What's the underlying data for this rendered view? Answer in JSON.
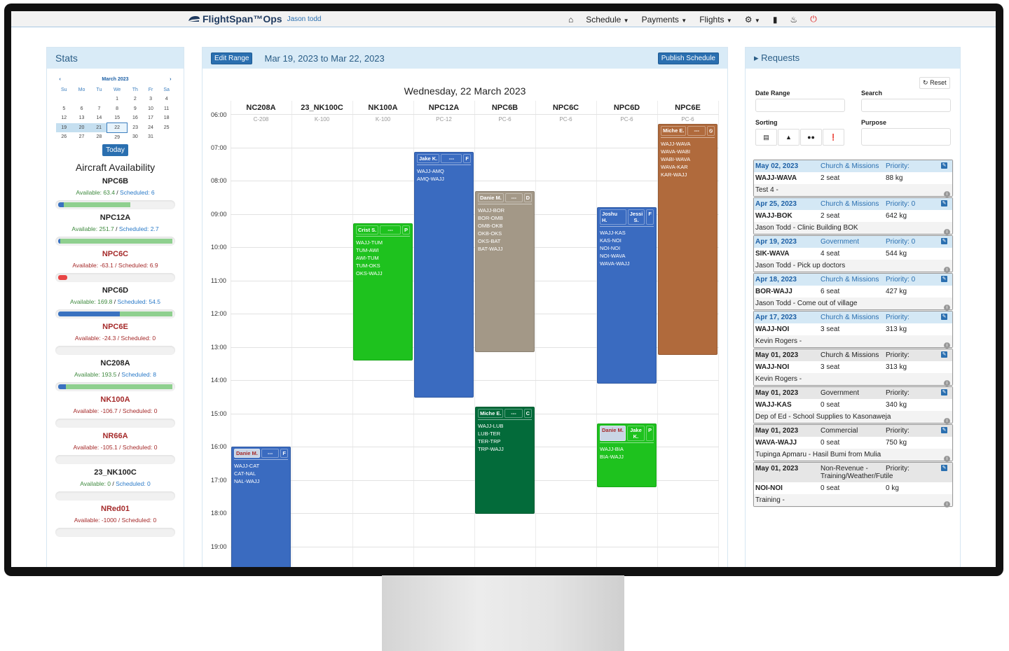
{
  "nav": {
    "brand": "FlightSpan™Ops",
    "user": "Jason todd",
    "items": [
      {
        "label": "Schedule"
      },
      {
        "label": "Payments"
      },
      {
        "label": "Flights"
      }
    ]
  },
  "stats": {
    "title": "Stats",
    "calendar": {
      "month": "March 2023",
      "prev": "‹",
      "next": "›",
      "weekdays": [
        "Su",
        "Mo",
        "Tu",
        "We",
        "Th",
        "Fr",
        "Sa"
      ],
      "weeks": [
        [
          "",
          "",
          "",
          "1",
          "2",
          "3",
          "4"
        ],
        [
          "5",
          "6",
          "7",
          "8",
          "9",
          "10",
          "11"
        ],
        [
          "12",
          "13",
          "14",
          "15",
          "16",
          "17",
          "18"
        ],
        [
          "19",
          "20",
          "21",
          "22",
          "23",
          "24",
          "25"
        ],
        [
          "26",
          "27",
          "28",
          "29",
          "30",
          "31",
          ""
        ]
      ],
      "range_days": [
        "19",
        "20",
        "21"
      ],
      "selected_day": "22",
      "today_label": "Today"
    },
    "availability_title": "Aircraft Availability",
    "aircraft": [
      {
        "name": "NPC6B",
        "available": "Available: 63.4",
        "scheduled": "Scheduled: 6",
        "negative": false,
        "sched_pct": 5,
        "avail_pct": 58
      },
      {
        "name": "NPC12A",
        "available": "Available: 251.7",
        "scheduled": "Scheduled: 2.7",
        "negative": false,
        "sched_pct": 2,
        "avail_pct": 98
      },
      {
        "name": "NPC6C",
        "available": "Available: -63.1",
        "scheduled": "Scheduled: 6.9",
        "negative": true,
        "sched_pct": 8,
        "avail_pct": 0
      },
      {
        "name": "NPC6D",
        "available": "Available: 169.8",
        "scheduled": "Scheduled: 54.5",
        "negative": false,
        "sched_pct": 54,
        "avail_pct": 46
      },
      {
        "name": "NPC6E",
        "available": "Available: -24.3",
        "scheduled": "Scheduled: 0",
        "negative": true,
        "sched_pct": 0,
        "avail_pct": 0
      },
      {
        "name": "NC208A",
        "available": "Available: 193.5",
        "scheduled": "Scheduled: 8",
        "negative": false,
        "sched_pct": 7,
        "avail_pct": 93
      },
      {
        "name": "NK100A",
        "available": "Available: -106.7",
        "scheduled": "Scheduled: 0",
        "negative": true,
        "sched_pct": 0,
        "avail_pct": 0
      },
      {
        "name": "NR66A",
        "available": "Available: -105.1",
        "scheduled": "Scheduled: 0",
        "negative": true,
        "sched_pct": 0,
        "avail_pct": 0
      },
      {
        "name": "23_NK100C",
        "available": "Available: 0",
        "scheduled": "Scheduled: 0",
        "negative": false,
        "sched_pct": 0,
        "avail_pct": 0
      },
      {
        "name": "NRed01",
        "available": "Available: -1000",
        "scheduled": "Scheduled: 0",
        "negative": true,
        "sched_pct": 0,
        "avail_pct": 0
      }
    ]
  },
  "schedule": {
    "edit_range": "Edit Range",
    "range": "Mar 19, 2023 to Mar 22, 2023",
    "publish": "Publish Schedule",
    "day_title": "Wednesday, 22 March 2023",
    "hours": [
      "06:00",
      "07:00",
      "08:00",
      "09:00",
      "10:00",
      "11:00",
      "12:00",
      "13:00",
      "14:00",
      "15:00",
      "16:00",
      "17:00",
      "18:00",
      "19:00"
    ],
    "columns": [
      {
        "reg": "NC208A",
        "type": "C-208"
      },
      {
        "reg": "23_NK100C",
        "type": "K-100"
      },
      {
        "reg": "NK100A",
        "type": "K-100"
      },
      {
        "reg": "NPC12A",
        "type": "PC-12"
      },
      {
        "reg": "NPC6B",
        "type": "PC-6"
      },
      {
        "reg": "NPC6C",
        "type": "PC-6"
      },
      {
        "reg": "NPC6D",
        "type": "PC-6"
      },
      {
        "reg": "NPC6E",
        "type": "PC-6"
      }
    ],
    "blocks": [
      {
        "col": 0,
        "start": "16:00",
        "end": "20:00",
        "color": "#3a6bc0",
        "pilot": "Danie M.",
        "copilot": "---",
        "code": "F",
        "pilot_hl": true,
        "copilot_hl": false,
        "routes": [
          "WAJJ-CAT",
          "CAT-NAL",
          "NAL-WAJJ"
        ]
      },
      {
        "col": 2,
        "start": "09:17",
        "end": "13:25",
        "color": "#1ec21e",
        "pilot": "Crist S.",
        "copilot": "---",
        "code": "P",
        "routes": [
          "WAJJ-TUM",
          "TUM-AWI",
          "AWI-TUM",
          "TUM-OKS",
          "OKS-WAJJ"
        ]
      },
      {
        "col": 3,
        "start": "07:08",
        "end": "14:32",
        "color": "#3a6bc0",
        "pilot": "Jake K.",
        "copilot": "---",
        "code": "F",
        "routes": [
          "WAJJ-AMQ",
          "AMQ-WAJJ"
        ]
      },
      {
        "col": 4,
        "start": "08:19",
        "end": "13:10",
        "color": "#a39887",
        "pilot": "Danie M.",
        "copilot": "---",
        "code": "D",
        "routes": [
          "WAJJ-BOR",
          "BOR-OMB",
          "OMB-OKB",
          "OKB-OKS",
          "OKS-BAT",
          "BAT-WAJJ"
        ]
      },
      {
        "col": 4,
        "start": "14:48",
        "end": "18:01",
        "color": "#036b3a",
        "pilot": "Miche E.",
        "copilot": "---",
        "code": "C",
        "routes": [
          "WAJJ-LUB",
          "LUB-TER",
          "TER-TRP",
          "TRP-WAJJ"
        ]
      },
      {
        "col": 6,
        "start": "08:48",
        "end": "14:06",
        "color": "#3a6bc0",
        "pilot": "Joshu H.",
        "copilot": "Jessi S.",
        "code": "F",
        "routes": [
          "WAJJ-KAS",
          "KAS-NOI",
          "NOI-NOI",
          "NOI-WAVA",
          "WAVA-WAJJ"
        ]
      },
      {
        "col": 6,
        "start": "15:18",
        "end": "17:13",
        "color": "#1ec21e",
        "pilot": "Danie M.",
        "copilot": "Jake K.",
        "code": "P",
        "pilot_hl": true,
        "routes": [
          "WAJJ-BIA",
          "BIA-WAJJ"
        ]
      },
      {
        "col": 7,
        "start": "06:18",
        "end": "13:15",
        "color": "#b06a3c",
        "pilot": "Miche E.",
        "copilot": "---",
        "code": "⦸",
        "routes": [
          "WAJJ-WAVA",
          "WAVA-WABI",
          "WABI-WAVA",
          "WAVA-KAR",
          "KAR-WAJJ"
        ]
      }
    ]
  },
  "requests": {
    "title": "Requests",
    "reset": "Reset",
    "date_range_label": "Date Range",
    "search_label": "Search",
    "sorting_label": "Sorting",
    "purpose_label": "Purpose",
    "sort_icons": [
      "calendar-icon",
      "weight-icon",
      "passengers-icon",
      "priority-icon"
    ],
    "items": [
      {
        "date": "May 02, 2023",
        "purpose": "Church & Missions",
        "priority": "Priority:",
        "route": "WAJJ-WAVA",
        "seats": "2 seat",
        "weight": "88 kg",
        "note": "Test 4 -",
        "highlight": true
      },
      {
        "date": "Apr 25, 2023",
        "purpose": "Church & Missions",
        "priority": "Priority: 0",
        "route": "WAJJ-BOK",
        "seats": "2 seat",
        "weight": "642 kg",
        "note": "Jason Todd - Clinic Building BOK",
        "highlight": true
      },
      {
        "date": "Apr 19, 2023",
        "purpose": "Government",
        "priority": "Priority: 0",
        "route": "SIK-WAVA",
        "seats": "4 seat",
        "weight": "544 kg",
        "note": "Jason Todd - Pick up doctors",
        "highlight": true
      },
      {
        "date": "Apr 18, 2023",
        "purpose": "Church & Missions",
        "priority": "Priority: 0",
        "route": "BOR-WAJJ",
        "seats": "6 seat",
        "weight": "427 kg",
        "note": "Jason Todd - Come out of village",
        "highlight": true
      },
      {
        "date": "Apr 17, 2023",
        "purpose": "Church & Missions",
        "priority": "Priority:",
        "route": "WAJJ-NOI",
        "seats": "3 seat",
        "weight": "313 kg",
        "note": "Kevin Rogers -",
        "highlight": true
      },
      {
        "date": "May 01, 2023",
        "purpose": "Church & Missions",
        "priority": "Priority:",
        "route": "WAJJ-NOI",
        "seats": "3 seat",
        "weight": "313 kg",
        "note": "Kevin Rogers -",
        "highlight": false
      },
      {
        "date": "May 01, 2023",
        "purpose": "Government",
        "priority": "Priority:",
        "route": "WAJJ-KAS",
        "seats": "0 seat",
        "weight": "340 kg",
        "note": "Dep of Ed - School Supplies to Kasonaweja",
        "highlight": false
      },
      {
        "date": "May 01, 2023",
        "purpose": "Commercial",
        "priority": "Priority:",
        "route": "WAVA-WAJJ",
        "seats": "0 seat",
        "weight": "750 kg",
        "note": "Tupinga Apmaru - Hasil Bumi from Mulia",
        "highlight": false
      },
      {
        "date": "May 01, 2023",
        "purpose": "Non-Revenue - Training/Weather/Futile",
        "priority": "Priority:",
        "route": "NOI-NOI",
        "seats": "0 seat",
        "weight": "0 kg",
        "note": "Training -",
        "highlight": false
      }
    ]
  }
}
